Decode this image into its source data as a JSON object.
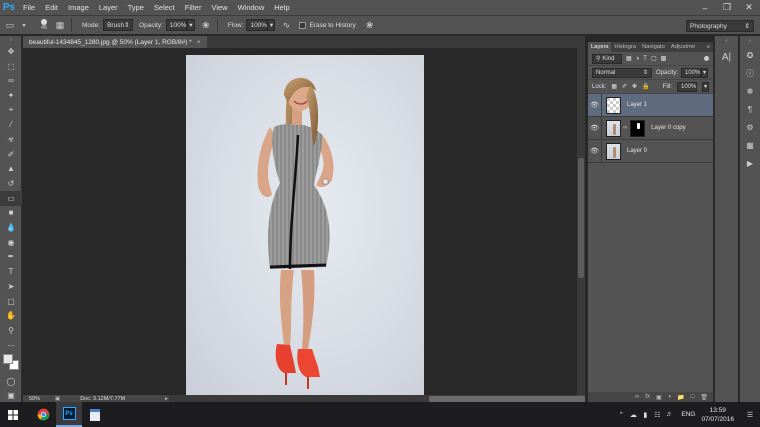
{
  "app": {
    "logo": "Ps"
  },
  "menu": [
    "File",
    "Edit",
    "Image",
    "Layer",
    "Type",
    "Select",
    "Filter",
    "View",
    "Window",
    "Help"
  ],
  "window_controls": [
    "minimize-icon",
    "restore-icon",
    "close-icon"
  ],
  "options": {
    "brush_size": "45",
    "mode_label": "Mode:",
    "mode_value": "Brush",
    "opacity_label": "Opacity:",
    "opacity_value": "100%",
    "flow_label": "Flow:",
    "flow_value": "100%",
    "erase_history_label": "Erase to History",
    "workspace": "Photography"
  },
  "document": {
    "tab_title": "beautiful-1434845_1280.jpg @ 50% (Layer 1, RGB/8#) *",
    "zoom": "50%",
    "doc_info": "Doc: 3.12M/7.77M"
  },
  "panel": {
    "tabs": [
      "Layers",
      "Histogra",
      "Navigato",
      "Adjustme"
    ],
    "filter_kind": "Kind",
    "blend_mode": "Normal",
    "opacity_label": "Opacity:",
    "opacity_value": "100%",
    "lock_label": "Lock:",
    "fill_label": "Fill:",
    "fill_value": "100%",
    "layers": [
      {
        "name": "Layer 1",
        "selected": true,
        "thumb": "transparent"
      },
      {
        "name": "Layer 0 copy",
        "selected": false,
        "thumb": "photo-mask"
      },
      {
        "name": "Layer 0",
        "selected": false,
        "thumb": "photo"
      }
    ]
  },
  "taskbar": {
    "apps": [
      "windows-start-icon",
      "chrome-icon",
      "photoshop-icon",
      "file-viewer-icon"
    ],
    "language": "ENG",
    "time": "13:59",
    "date": "07/07/2016"
  },
  "colors": {
    "accent": "#31a8ff",
    "selected_layer": "#5f6b7e",
    "heel_red": "#e8402f"
  }
}
